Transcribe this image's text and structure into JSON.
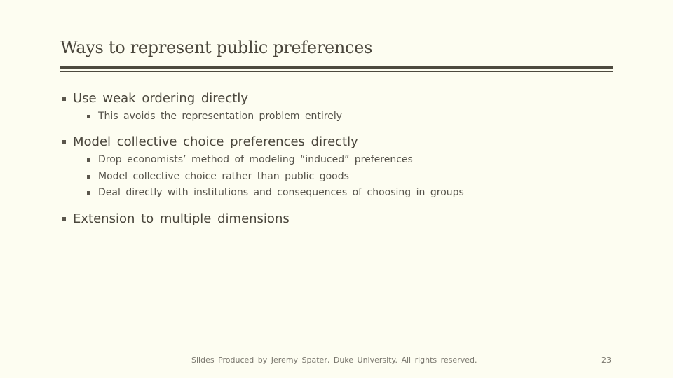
{
  "slide": {
    "title": "Ways to represent public preferences",
    "bullets": [
      {
        "text": "Use weak ordering directly",
        "sub": [
          "This avoids the representation problem entirely"
        ]
      },
      {
        "text": "Model collective choice preferences directly",
        "sub": [
          "Drop economists’ method of modeling “induced” preferences",
          "Model collective choice rather than public goods",
          "Deal directly with institutions and consequences of choosing in groups"
        ]
      },
      {
        "text": "Extension to multiple dimensions",
        "sub": []
      }
    ],
    "footer": "Slides Produced by Jeremy Spater, Duke University.  All rights reserved.",
    "page_number": "23",
    "bullet_icon": "square-bullet-icon",
    "colors": {
      "background": "#fdfdf1",
      "text": "#4a463c",
      "rule": "#4d4a3f"
    }
  }
}
